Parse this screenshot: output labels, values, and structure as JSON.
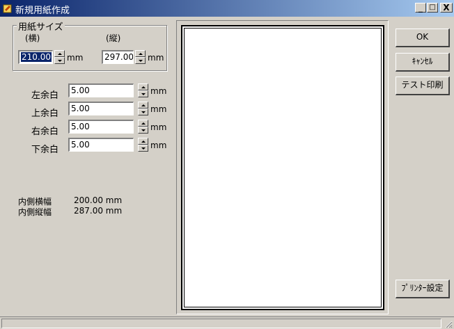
{
  "window": {
    "title": "新規用紙作成",
    "controls": {
      "minimize": "_",
      "maximize": "□",
      "close": "X"
    }
  },
  "paper_size": {
    "group_label": "用紙サイズ",
    "width_label": "(横)",
    "height_label": "(縦)",
    "width_value": "210.00",
    "height_value": "297.00",
    "unit": "mm"
  },
  "margins": [
    {
      "label": "左余白",
      "value": "5.00",
      "unit": "mm"
    },
    {
      "label": "上余白",
      "value": "5.00",
      "unit": "mm"
    },
    {
      "label": "右余白",
      "value": "5.00",
      "unit": "mm"
    },
    {
      "label": "下余白",
      "value": "5.00",
      "unit": "mm"
    }
  ],
  "inner_size": {
    "width_label": "内側横幅",
    "width_value": "200.00 mm",
    "height_label": "内側縦幅",
    "height_value": "287.00 mm"
  },
  "buttons": {
    "ok": "OK",
    "cancel": "ｷｬﾝｾﾙ",
    "test_print": "テスト印刷",
    "printer_setup": "ﾌﾟﾘﾝﾀｰ設定"
  }
}
